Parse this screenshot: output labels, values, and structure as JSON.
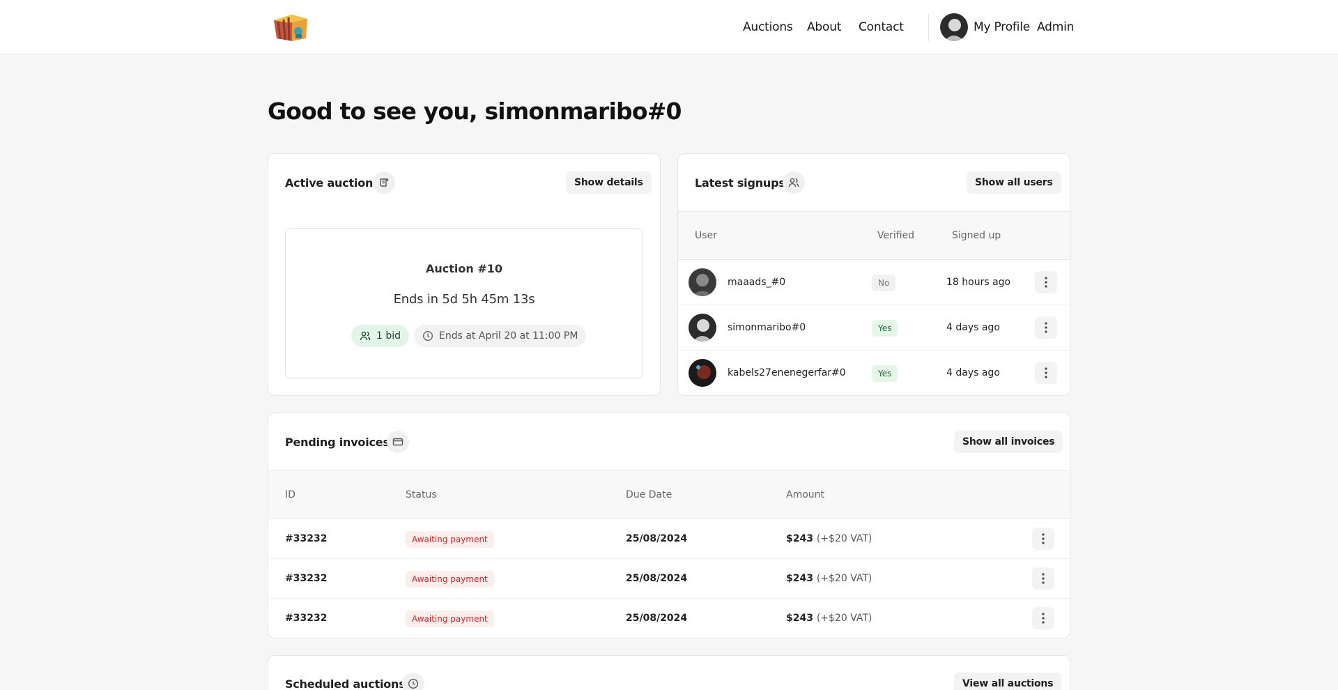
{
  "nav": {
    "auctions": "Auctions",
    "about": "About",
    "contact": "Contact",
    "profile": "My Profile",
    "admin": "Admin"
  },
  "greeting": "Good to see you, simonmaribo#0",
  "active_auction": {
    "title": "Active auction",
    "button": "Show details",
    "name": "Auction #10",
    "ends_in": "Ends in 5d 5h 45m 13s",
    "bids": "1 bid",
    "ends_at": "Ends at April 20 at 11:00 PM"
  },
  "signups": {
    "title": "Latest signups",
    "button": "Show all users",
    "headers": {
      "user": "User",
      "verified": "Verified",
      "signed_up": "Signed up"
    },
    "rows": [
      {
        "user": "maaads_#0",
        "verified": "No",
        "signed_up": "18 hours ago"
      },
      {
        "user": "simonmaribo#0",
        "verified": "Yes",
        "signed_up": "4 days ago"
      },
      {
        "user": "kabels27enenegerfar#0",
        "verified": "Yes",
        "signed_up": "4 days ago"
      }
    ]
  },
  "invoices": {
    "title": "Pending invoices",
    "button": "Show all invoices",
    "headers": {
      "id": "ID",
      "status": "Status",
      "due": "Due Date",
      "amount": "Amount"
    },
    "rows": [
      {
        "id": "#33232",
        "status": "Awaiting payment",
        "due": "25/08/2024",
        "amount": "$243",
        "vat": "(+$20 VAT)"
      },
      {
        "id": "#33232",
        "status": "Awaiting payment",
        "due": "25/08/2024",
        "amount": "$243",
        "vat": "(+$20 VAT)"
      },
      {
        "id": "#33232",
        "status": "Awaiting payment",
        "due": "25/08/2024",
        "amount": "$243",
        "vat": "(+$20 VAT)"
      }
    ]
  },
  "scheduled": {
    "title": "Scheduled auctions",
    "button": "View all auctions"
  },
  "colors": {
    "background": "#f6f6f6",
    "badge_yes": "#246b38",
    "badge_red": "#c62828",
    "bid_pill": "#e3f5e8"
  }
}
